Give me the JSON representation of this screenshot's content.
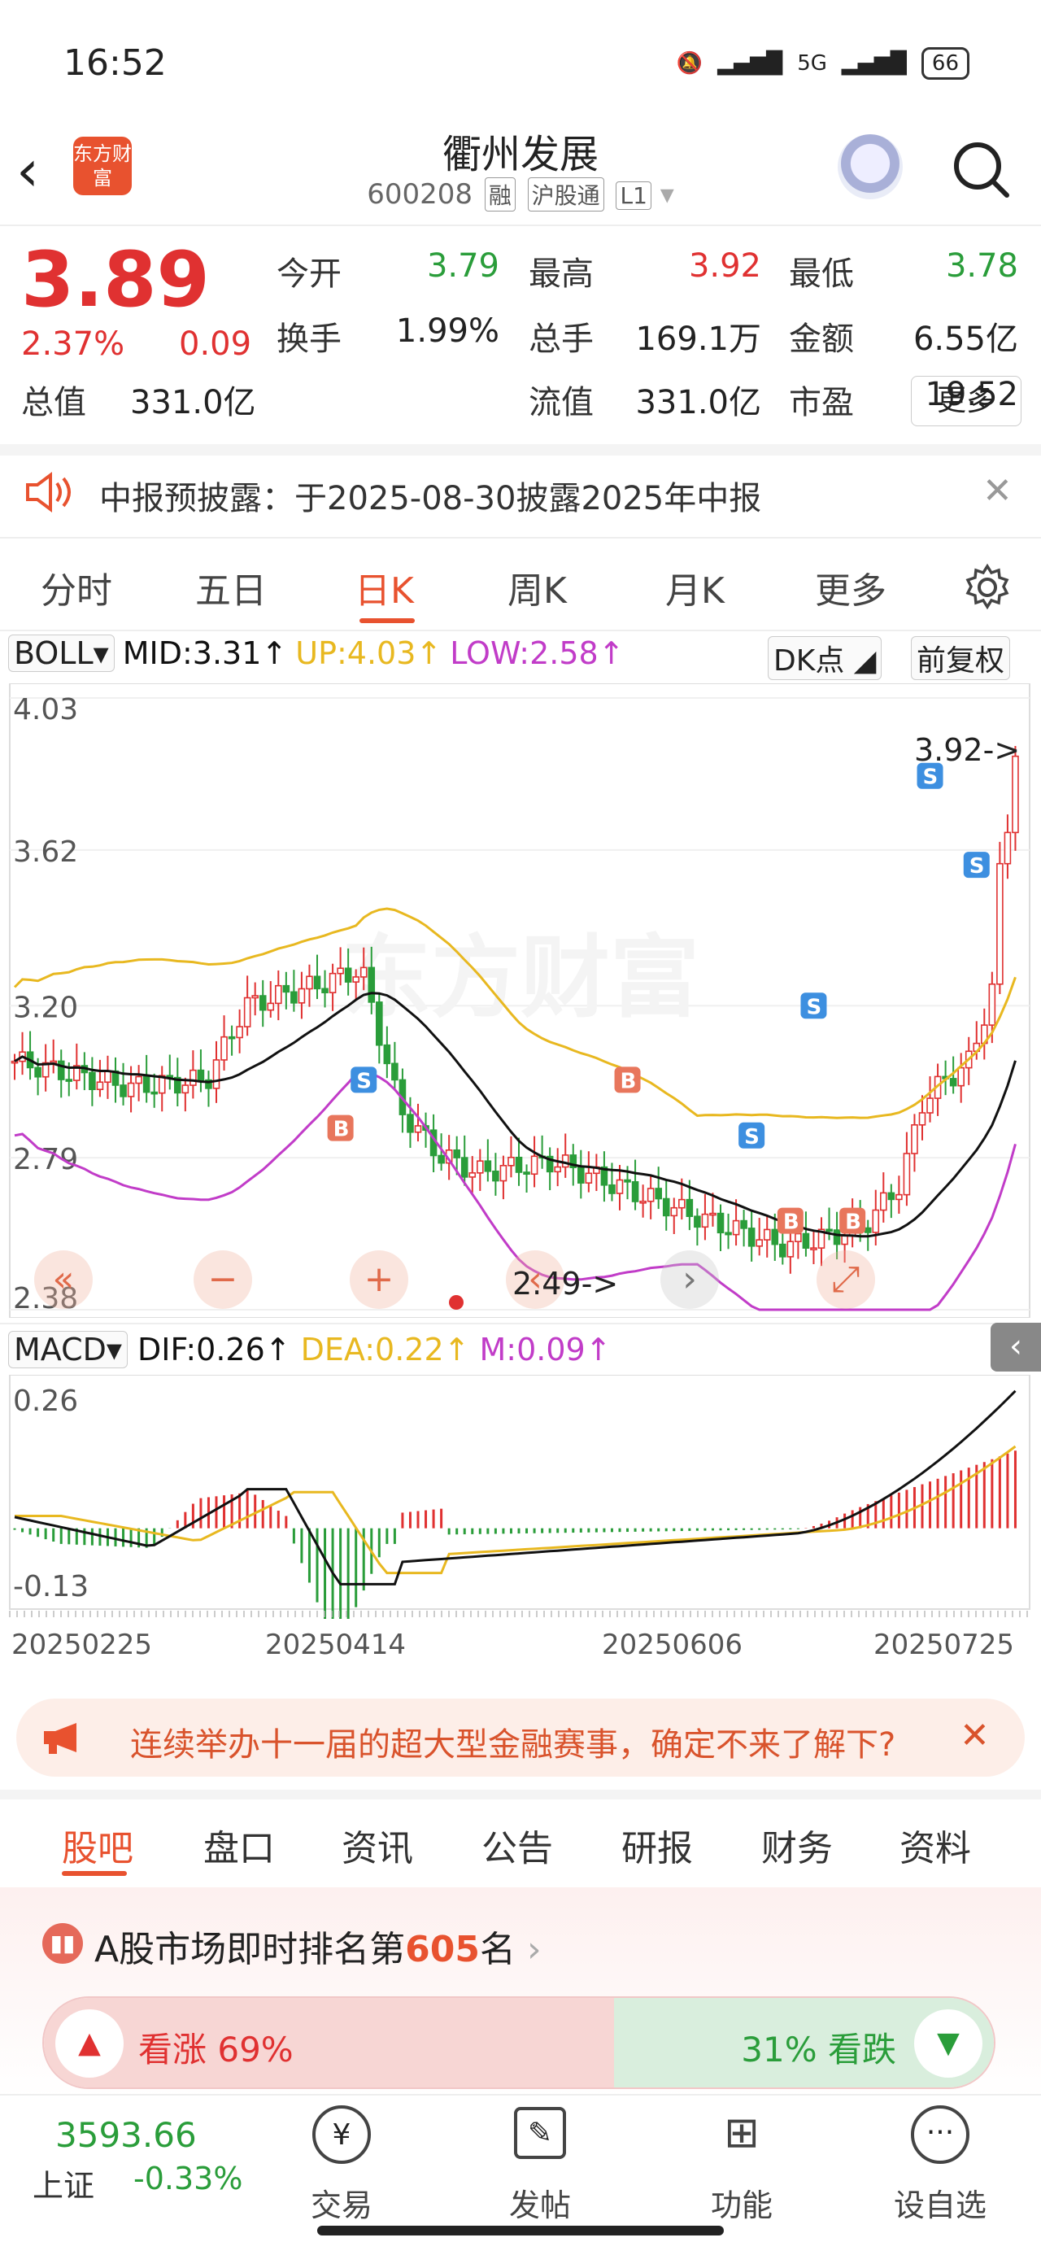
{
  "status_bar": {
    "time": "16:52",
    "net": "5G",
    "battery": "66"
  },
  "header": {
    "title": "衢州发展",
    "code": "600208",
    "tags": [
      "融",
      "沪股通",
      "L1"
    ],
    "logo_text": "东方财富"
  },
  "quote": {
    "price": "3.89",
    "change_pct": "2.37%",
    "change": "0.09",
    "fields": [
      {
        "label": "今开",
        "value": "3.79",
        "color": "green"
      },
      {
        "label": "最高",
        "value": "3.92",
        "color": "red"
      },
      {
        "label": "最低",
        "value": "3.78",
        "color": "green"
      },
      {
        "label": "换手",
        "value": "1.99%",
        "color": "black"
      },
      {
        "label": "总手",
        "value": "169.1万",
        "color": "black"
      },
      {
        "label": "金额",
        "value": "6.55亿",
        "color": "black"
      },
      {
        "label": "总值",
        "value": "331.0亿",
        "color": "black"
      },
      {
        "label": "流值",
        "value": "331.0亿",
        "color": "black"
      },
      {
        "label": "市盈",
        "value": "19.52",
        "color": "black"
      }
    ],
    "more_label": "更多"
  },
  "notice": {
    "text": "中报预披露：于2025-08-30披露2025年中报"
  },
  "chart_tabs": [
    "分时",
    "五日",
    "日K",
    "周K",
    "月K",
    "更多"
  ],
  "active_tab": "日K",
  "boll": {
    "name": "BOLL",
    "mid": "MID:3.31↑",
    "up": "UP:4.03↑",
    "low": "LOW:2.58↑",
    "dk": "DK点",
    "fq": "前复权"
  },
  "price_axis": [
    "4.03",
    "3.62",
    "3.20",
    "2.79",
    "2.38"
  ],
  "annotations": {
    "high": "3.92->",
    "low": "2.49->"
  },
  "macd": {
    "name": "MACD",
    "dif": "DIF:0.26↑",
    "dea": "DEA:0.22↑",
    "m": "M:0.09↑",
    "axis_top": "0.26",
    "axis_bottom": "-0.13"
  },
  "dates": [
    "20250225",
    "20250414",
    "20250606",
    "20250725"
  ],
  "colors": {
    "up": "#e03131",
    "down": "#2a9d3a",
    "mid": "#111111",
    "upper": "#e8b820",
    "lower": "#c13cc8",
    "accent": "#e8522f"
  },
  "banner": {
    "text": "连续举办十一届的超大型金融赛事，确定不来了解下?"
  },
  "bottom_tabs": [
    "股吧",
    "盘口",
    "资讯",
    "公告",
    "研报",
    "财务",
    "资料"
  ],
  "rank": {
    "prefix": "A股市场即时排名第",
    "num": "605",
    "suffix": "名"
  },
  "vote": {
    "up": "看涨 69%",
    "down": "31% 看跌",
    "up_ratio": 0.69
  },
  "bottom_nav": {
    "index_value": "3593.66",
    "index_name": "上证",
    "index_change": "-0.33%",
    "items": [
      "交易",
      "发帖",
      "功能",
      "设自选"
    ]
  }
}
